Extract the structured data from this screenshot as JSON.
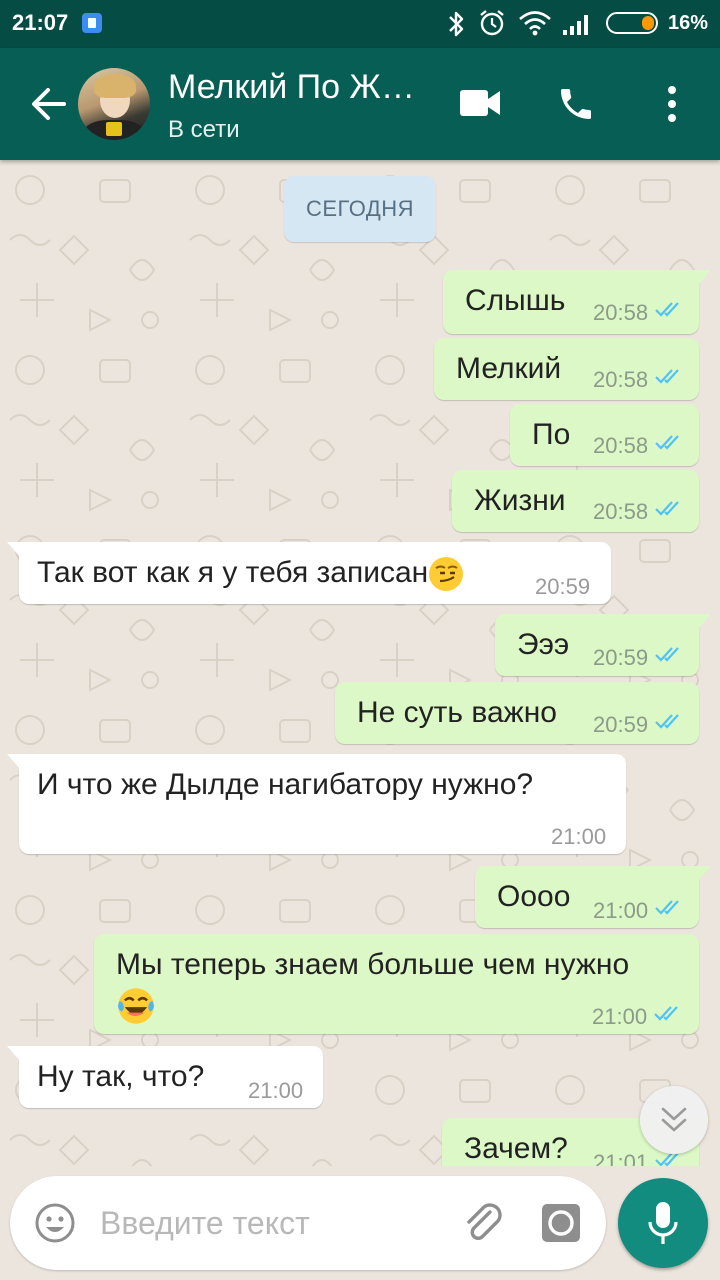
{
  "status_bar": {
    "time": "21:07",
    "battery_percent": "16%",
    "battery_level": 0.16,
    "icons": [
      "notification-app-icon",
      "bluetooth-icon",
      "alarm-icon",
      "wifi-icon",
      "signal-icon",
      "battery-icon"
    ]
  },
  "header": {
    "contact_name": "Мелкий По Ж…",
    "status": "В сети",
    "icons": [
      "back-arrow-icon",
      "avatar",
      "video-call-icon",
      "phone-call-icon",
      "more-vert-icon"
    ]
  },
  "chat": {
    "date_label": "СЕГОДНЯ",
    "messages": [
      {
        "dir": "out",
        "text": "Слышь",
        "time": "20:58",
        "read": true
      },
      {
        "dir": "out",
        "text": "Мелкий",
        "time": "20:58",
        "read": true
      },
      {
        "dir": "out",
        "text": "По",
        "time": "20:58",
        "read": true
      },
      {
        "dir": "out",
        "text": "Жизни",
        "time": "20:58",
        "read": true
      },
      {
        "dir": "in",
        "text": "Так вот как я у тебя записан",
        "emoji": "smirking-face-emoji",
        "time": "20:59"
      },
      {
        "dir": "out",
        "text": "Эээ",
        "time": "20:59",
        "read": true
      },
      {
        "dir": "out",
        "text": "Не суть важно",
        "time": "20:59",
        "read": true
      },
      {
        "dir": "in",
        "text": "И что же Дылде нагибатору нужно?",
        "time": "21:00"
      },
      {
        "dir": "out",
        "text": "Оооо",
        "time": "21:00",
        "read": true
      },
      {
        "dir": "out",
        "text": "Мы теперь знаем больше чем нужно",
        "emoji": "tears-of-joy-emoji",
        "time": "21:00",
        "read": true
      },
      {
        "dir": "in",
        "text": "Ну так, что?",
        "time": "21:00"
      },
      {
        "dir": "out",
        "text": "Зачем?",
        "time": "21:01",
        "read": true
      }
    ]
  },
  "input": {
    "placeholder": "Введите текст",
    "value": "",
    "icons": [
      "emoji-icon",
      "attach-icon",
      "camera-icon",
      "mic-icon"
    ]
  },
  "colors": {
    "header_bg": "#075e54",
    "statusbar_bg": "#054d44",
    "outgoing_bubble": "#dcf8c6",
    "incoming_bubble": "#ffffff",
    "chat_bg": "#ece5dd",
    "read_ticks": "#4fc3f7",
    "mic_button": "#128c7e",
    "date_chip": "#d5e7f3"
  }
}
